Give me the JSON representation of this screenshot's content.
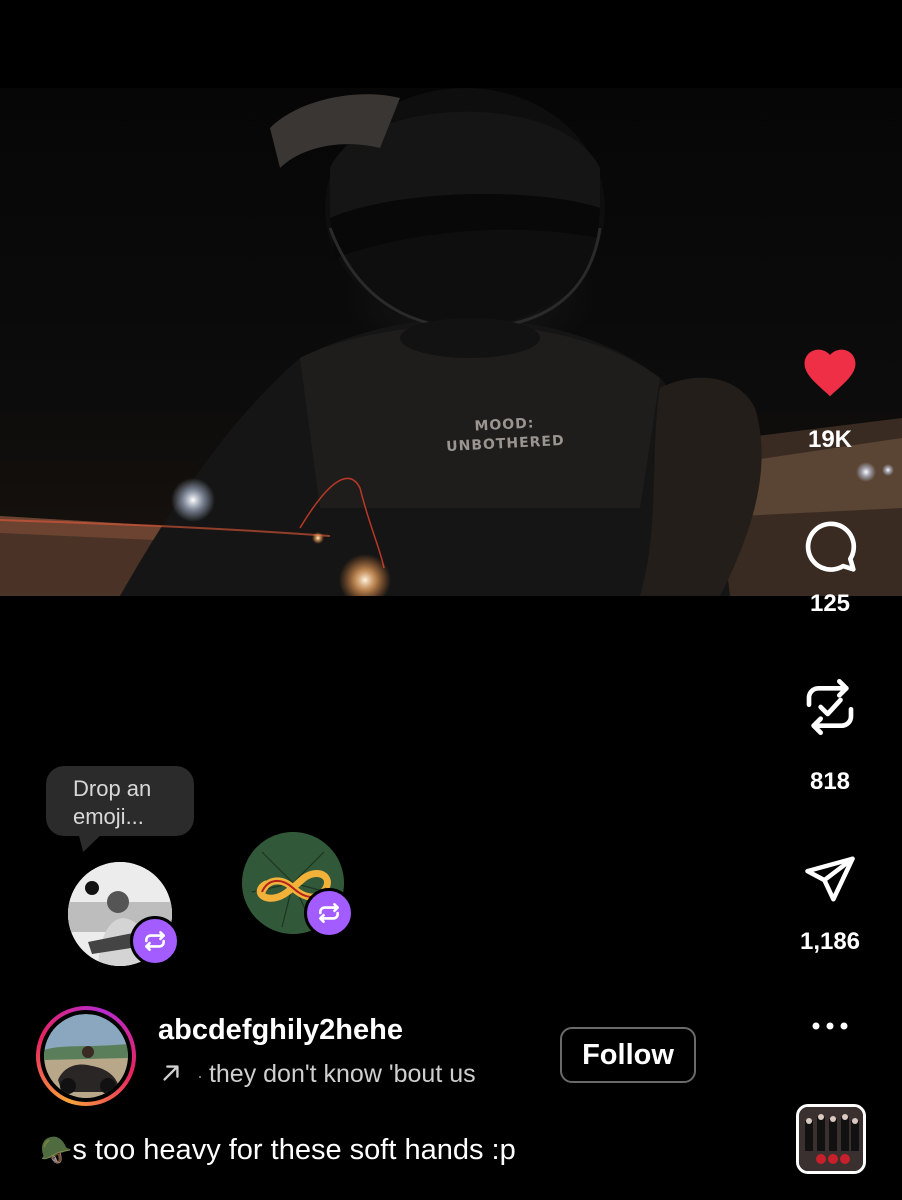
{
  "video": {
    "shirt_text_line1": "MOOD:",
    "shirt_text_line2": "UNBOTHERED"
  },
  "rail": {
    "like_count": "19K",
    "comment_count": "125",
    "repost_count": "818",
    "share_count": "1,186",
    "liked": true,
    "like_color": "#ee2f45"
  },
  "reactions": {
    "tooltip_text": "Drop an emoji...",
    "badge_color": "#a35cff"
  },
  "author": {
    "username": "abcdefghily2hehe",
    "music_arrow_icon": "arrow-up-right-icon",
    "music_separator": "·",
    "music_text": "they don't know 'bout us",
    "follow_label": "Follow",
    "story_ring_colors": [
      "#f9a33a",
      "#e9235f",
      "#b62bd0"
    ]
  },
  "caption": {
    "emoji": "🪖",
    "text": "s too heavy for these soft hands :p"
  }
}
